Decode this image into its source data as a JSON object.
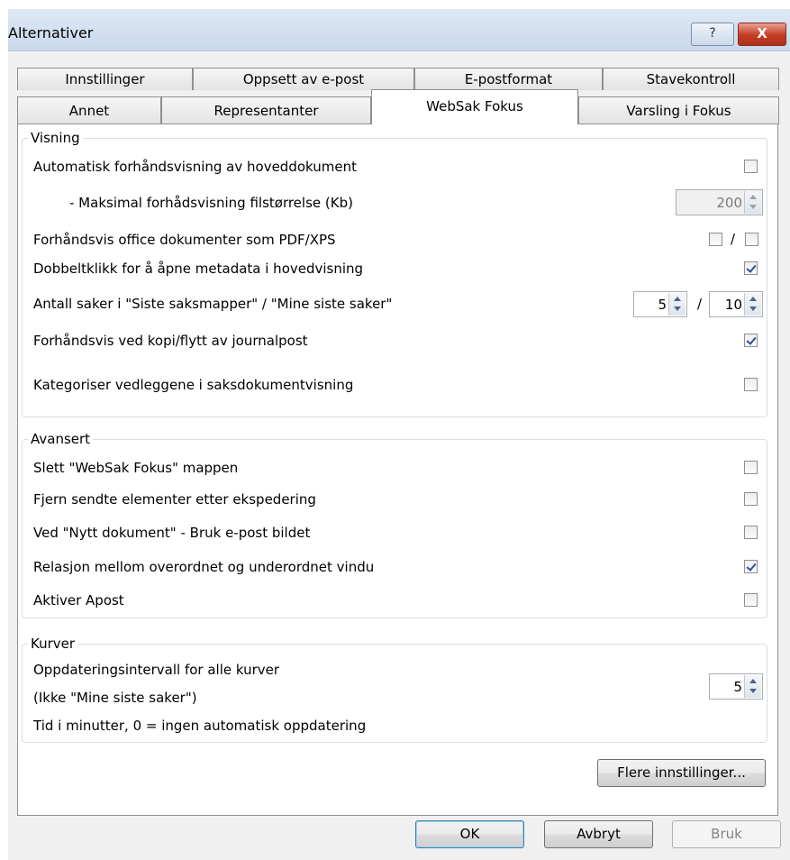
{
  "window": {
    "title": "Alternativer",
    "help_label": "?",
    "close_label": "X"
  },
  "tabs": {
    "row1": [
      "Innstillinger",
      "Oppsett av e-post",
      "E-postformat",
      "Stavekontroll"
    ],
    "row2": [
      "Annet",
      "Representanter",
      "WebSak Fokus",
      "Varsling i Fokus"
    ],
    "active": "WebSak Fokus"
  },
  "visning": {
    "title": "Visning",
    "auto_preview": {
      "label": "Automatisk forhåndsvisning av hoveddokument",
      "checked": false
    },
    "max_preview": {
      "label": "- Maksimal forhådsvisning filstørrelse (Kb)",
      "value": "200"
    },
    "office_preview": {
      "label": "Forhåndsvis office dokumenter som PDF/XPS",
      "pdf_checked": false,
      "xps_checked": false,
      "separator": "/"
    },
    "double_click": {
      "label": "Dobbeltklikk for å åpne metadata i hovedvisning",
      "checked": true
    },
    "case_count": {
      "label": "Antall saker i \"Siste saksmapper\" / \"Mine siste saker\"",
      "value1": "5",
      "value2": "10",
      "separator": "/"
    },
    "copy_move_preview": {
      "label": "Forhåndsvis ved kopi/flytt av journalpost",
      "checked": true
    },
    "categorize": {
      "label": "Kategoriser vedleggene i saksdokumentvisning",
      "checked": false
    }
  },
  "avansert": {
    "title": "Avansert",
    "items": [
      {
        "label": "Slett \"WebSak Fokus\" mappen",
        "checked": false
      },
      {
        "label": "Fjern sendte elementer etter ekspedering",
        "checked": false
      },
      {
        "label": "Ved \"Nytt dokument\" - Bruk e-post bildet",
        "checked": false
      },
      {
        "label": "Relasjon mellom overordnet og underordnet vindu",
        "checked": true
      },
      {
        "label": "Aktiver  Apost",
        "checked": false
      }
    ]
  },
  "kurver": {
    "title": "Kurver",
    "line1": "Oppdateringsintervall for alle kurver",
    "line2": "(Ikke \"Mine siste saker\")",
    "line3": "Tid i minutter, 0 = ingen automatisk oppdatering",
    "interval": "5"
  },
  "buttons": {
    "more_settings": "Flere innstillinger...",
    "ok": "OK",
    "cancel": "Avbryt",
    "apply": "Bruk"
  }
}
